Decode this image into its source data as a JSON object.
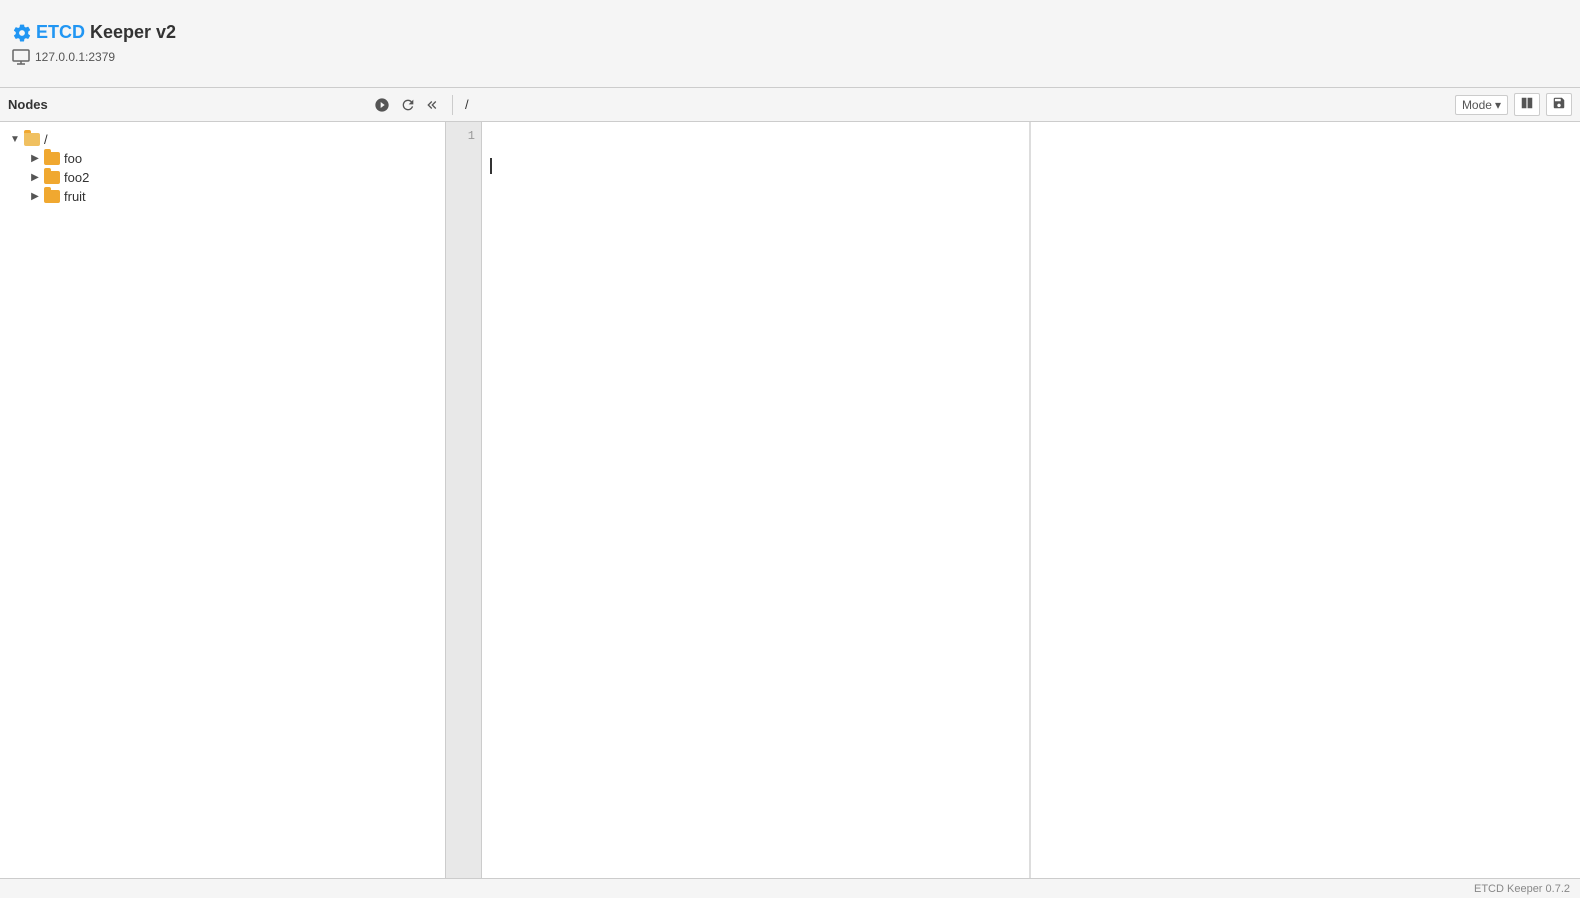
{
  "app": {
    "title_etcd": "ETCD",
    "title_rest": " Keeper v2",
    "server_address": "127.0.0.1:2379",
    "version": "ETCD Keeper 0.7.2"
  },
  "header": {
    "nodes_label": "Nodes",
    "path": "/"
  },
  "toolbar": {
    "mode_label": "Mode",
    "icons": {
      "settings": "⚙",
      "refresh": "↺",
      "collapse": "«"
    }
  },
  "tree": {
    "root": {
      "label": "/",
      "expanded": true
    },
    "children": [
      {
        "label": "foo",
        "expanded": false,
        "indent": 1
      },
      {
        "label": "foo2",
        "expanded": false,
        "indent": 1
      },
      {
        "label": "fruit",
        "expanded": false,
        "indent": 1
      }
    ]
  },
  "editor": {
    "line_numbers": [
      "1"
    ],
    "content": ""
  },
  "footer": {
    "version": "ETCD Keeper 0.7.2"
  }
}
